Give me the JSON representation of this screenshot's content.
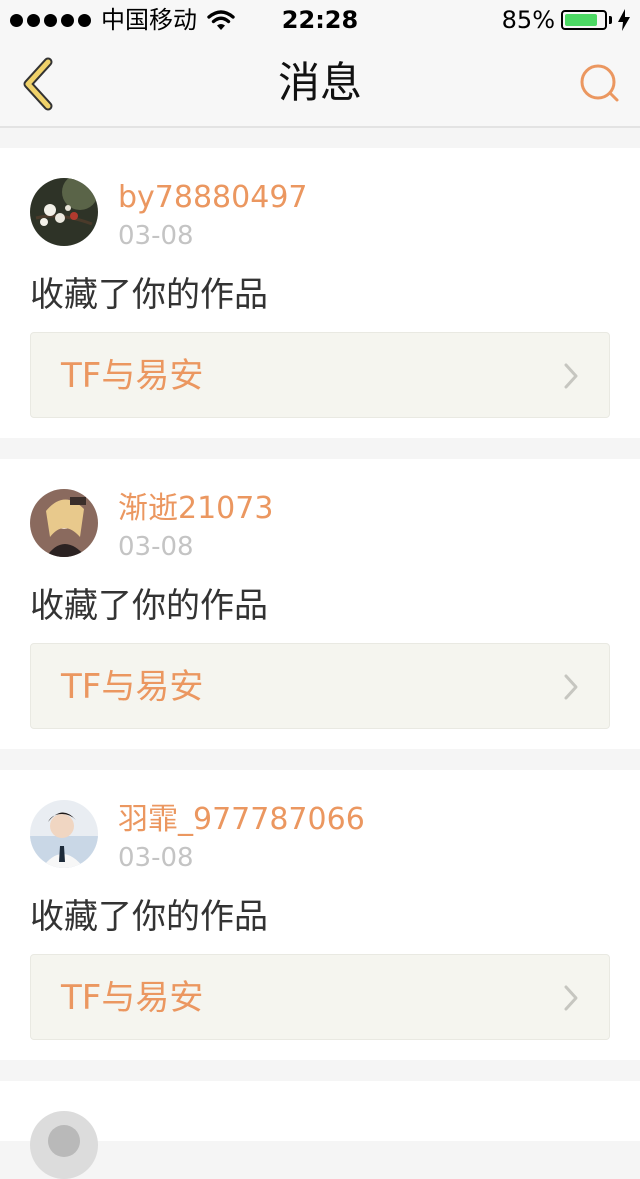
{
  "status_bar": {
    "carrier": "中国移动",
    "time": "22:28",
    "battery": "85%",
    "battery_level": 0.85
  },
  "nav": {
    "title": "消息",
    "back_icon": "chevron-left-icon",
    "search_icon": "search-icon"
  },
  "colors": {
    "accent": "#eb9760",
    "back_icon": "#f0d26a",
    "battery": "#4cd964"
  },
  "messages": [
    {
      "username": "by78880497",
      "date": "03-08",
      "action": "收藏了你的作品",
      "work_title": "TF与易安"
    },
    {
      "username": "渐逝21073",
      "date": "03-08",
      "action": "收藏了你的作品",
      "work_title": "TF与易安"
    },
    {
      "username": "羽霏_977787066",
      "date": "03-08",
      "action": "收藏了你的作品",
      "work_title": "TF与易安"
    }
  ]
}
